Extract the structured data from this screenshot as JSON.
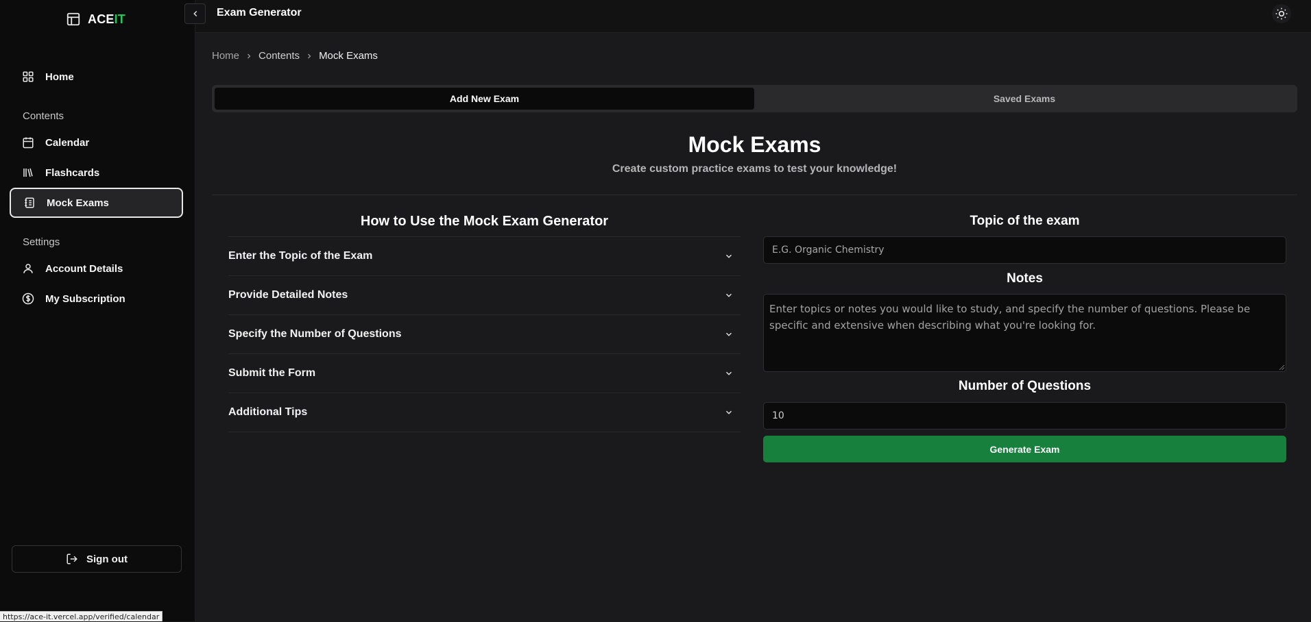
{
  "sidebar": {
    "logo_main": "ACE",
    "logo_accent": "IT",
    "items": {
      "home": "Home",
      "contents_section": "Contents",
      "calendar": "Calendar",
      "flashcards": "Flashcards",
      "mock_exams": "Mock Exams",
      "settings_section": "Settings",
      "account": "Account Details",
      "subscription": "My Subscription"
    },
    "signout": "Sign out"
  },
  "status_url": "https://ace-it.vercel.app/verified/calendar",
  "topbar": {
    "title": "Exam Generator"
  },
  "breadcrumb": {
    "home": "Home",
    "contents": "Contents",
    "current": "Mock Exams"
  },
  "tabs": {
    "add": "Add New Exam",
    "saved": "Saved Exams"
  },
  "hero": {
    "title": "Mock Exams",
    "subtitle": "Create custom practice exams to test your knowledge!"
  },
  "howto": {
    "title": "How to Use the Mock Exam Generator",
    "items": [
      "Enter the Topic of the Exam",
      "Provide Detailed Notes",
      "Specify the Number of Questions",
      "Submit the Form",
      "Additional Tips"
    ]
  },
  "form": {
    "topic_label": "Topic of the exam",
    "topic_placeholder": "E.G. Organic Chemistry",
    "notes_label": "Notes",
    "notes_placeholder": "Enter topics or notes you would like to study, and specify the number of questions. Please be specific and extensive when describing what you're looking for.",
    "count_label": "Number of Questions",
    "count_value": "10",
    "submit": "Generate Exam"
  },
  "colors": {
    "accent": "#22c55e",
    "button": "#16803c"
  }
}
